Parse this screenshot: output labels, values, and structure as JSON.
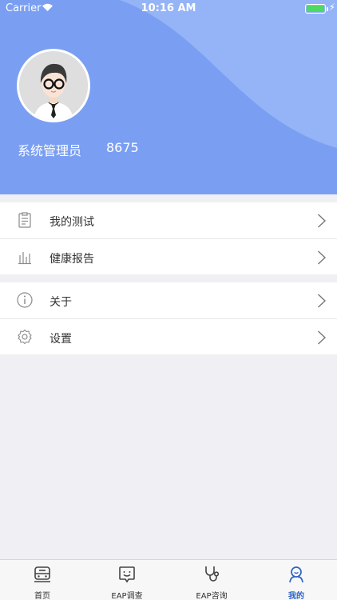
{
  "status_bar": {
    "carrier": "Carrier",
    "time": "10:16 AM",
    "battery_level": 0.9,
    "battery_color": "#4cd964"
  },
  "profile": {
    "name": "系统管理员",
    "id": "8675",
    "avatar_icon": "avatar-person-with-glasses"
  },
  "menu_group_1": [
    {
      "label": "我的测试",
      "icon": "clipboard-icon"
    },
    {
      "label": "健康报告",
      "icon": "bar-chart-icon"
    }
  ],
  "menu_group_2": [
    {
      "label": "关于",
      "icon": "info-icon"
    },
    {
      "label": "设置",
      "icon": "gear-icon"
    }
  ],
  "tabbar": {
    "tabs": [
      {
        "label": "首页",
        "icon": "bus-icon",
        "active": false
      },
      {
        "label": "EAP调查",
        "icon": "chat-face-icon",
        "active": false
      },
      {
        "label": "EAP咨询",
        "icon": "stethoscope-icon",
        "active": false
      },
      {
        "label": "我的",
        "icon": "person-icon",
        "active": true
      }
    ]
  },
  "colors": {
    "header_bg": "#7a9ff2",
    "header_light": "#94b4f7",
    "accent": "#2e64c6",
    "page_bg": "#efeff4"
  }
}
